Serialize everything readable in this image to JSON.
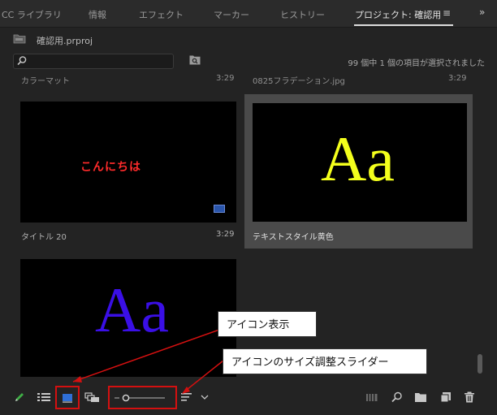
{
  "tabs": [
    {
      "label": "CC ライブラリ"
    },
    {
      "label": "情報"
    },
    {
      "label": "エフェクト"
    },
    {
      "label": "マーカー"
    },
    {
      "label": "ヒストリー"
    },
    {
      "label": "プロジェクト: 確認用"
    }
  ],
  "active_tab_index": 5,
  "project": {
    "name": "確認用.prproj"
  },
  "search": {
    "value": "",
    "placeholder": ""
  },
  "status": "99 個中 1 個の項目が選択されました",
  "previous_row": {
    "left_title": "カラーマット",
    "left_time": "3:29",
    "right_title": "0825フラデーション.jpg",
    "right_time": "3:29"
  },
  "items": [
    {
      "title": "タイトル 20",
      "duration": "3:29",
      "thumb_text": "こんにちは",
      "thumb_color": "#ff2b2b",
      "selected": false
    },
    {
      "title": "テキストスタイル黄色",
      "duration": "",
      "thumb_text": "Aa",
      "thumb_color": "#f4ff1c",
      "selected": true
    },
    {
      "title": "",
      "duration": "",
      "thumb_text": "Aa",
      "thumb_color": "#3a0fe6",
      "selected": false
    }
  ],
  "callouts": {
    "icon_view": "アイコン表示",
    "size_slider": "アイコンのサイズ調整スライダー"
  },
  "toolbar": {
    "icons": [
      "pencil-icon",
      "list-view-icon",
      "icon-view-icon",
      "freeform-view-icon",
      "size-slider",
      "sort-icon",
      "chevron-down-icon",
      "automate-icon",
      "find-icon",
      "new-bin-icon",
      "new-item-icon",
      "trash-icon"
    ]
  },
  "colors": {
    "accent_highlight": "#d41010",
    "selected_card": "#4a4a4a",
    "icon_view_active": "#2f6fd6"
  }
}
